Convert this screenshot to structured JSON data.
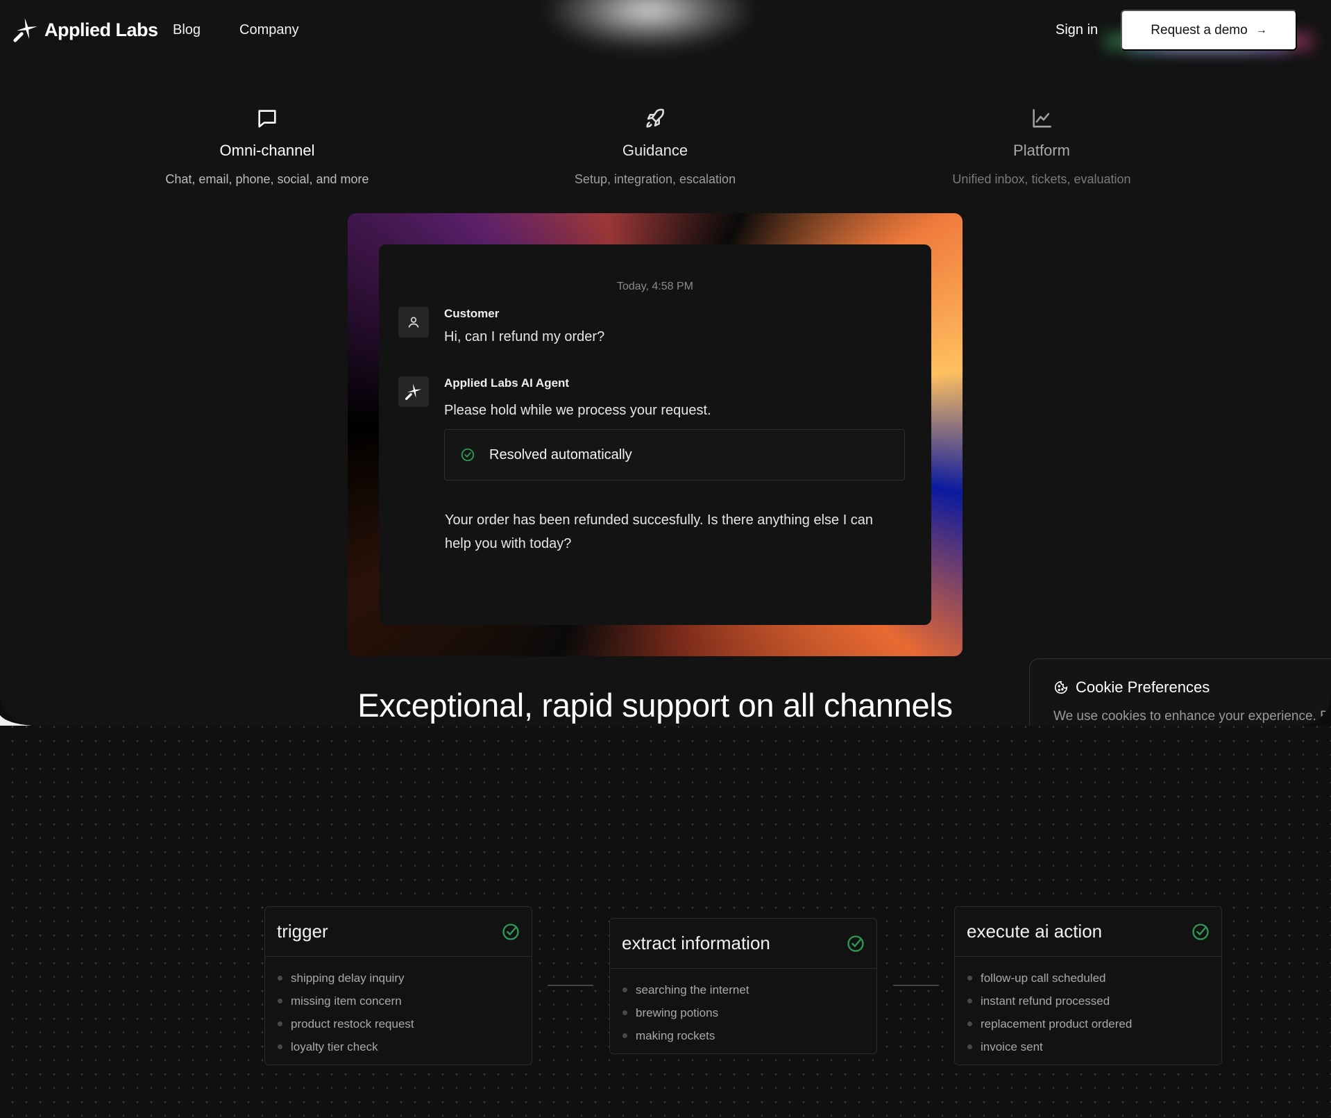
{
  "brand": {
    "name": "Applied Labs"
  },
  "nav": {
    "blog": "Blog",
    "company": "Company",
    "sign_in": "Sign in",
    "demo": "Request a demo",
    "demo_icon": "arrow-right-icon"
  },
  "features": [
    {
      "title": "Omni-channel",
      "description": "Chat, email, phone, social, and more",
      "icon": "chat-bubble-icon"
    },
    {
      "title": "Guidance",
      "description": "Setup, integration, escalation",
      "icon": "rocket-icon"
    },
    {
      "title": "Platform",
      "description": "Unified inbox, tickets, evaluation",
      "icon": "line-chart-icon"
    }
  ],
  "chat": {
    "timestamp": "Today, 4:58 PM",
    "customer_name": "Customer",
    "customer_message": "Hi, can I refund my order?",
    "agent_name": "Applied Labs AI Agent",
    "agent_message": "Please hold while we process your request.",
    "status": "Resolved automatically",
    "reply": "Your order has been refunded succesfully. Is there anything else I can help you with today?"
  },
  "headline": "Exceptional, rapid support on all channels",
  "cookie": {
    "title": "Cookie Preferences",
    "description": "We use cookies to enhance your experience. B"
  },
  "workflow": [
    {
      "title": "trigger",
      "items": [
        "shipping delay inquiry",
        "missing item concern",
        "product restock request",
        "loyalty tier check"
      ]
    },
    {
      "title": "extract information",
      "items": [
        "searching the internet",
        "brewing potions",
        "making rockets"
      ]
    },
    {
      "title": "execute ai action",
      "items": [
        "follow-up call scheduled",
        "instant refund processed",
        "replacement product ordered",
        "invoice sent"
      ]
    }
  ],
  "colors": {
    "background": "#131313",
    "accent_green": "#2f9a55",
    "button_bg": "#ffffff"
  }
}
